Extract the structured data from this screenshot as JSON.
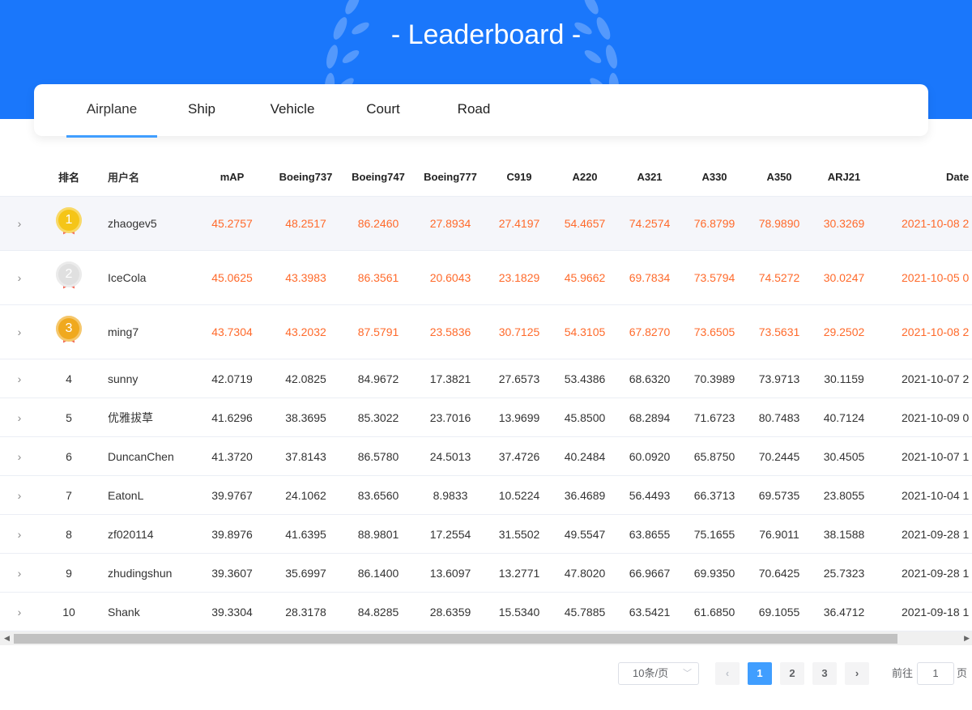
{
  "header": {
    "title": "- Leaderboard -",
    "brand_color": "#1a77fb"
  },
  "tabs": [
    {
      "label": "Airplane",
      "active": true
    },
    {
      "label": "Ship"
    },
    {
      "label": "Vehicle"
    },
    {
      "label": "Court"
    },
    {
      "label": "Road"
    }
  ],
  "columns": [
    "排名",
    "用户名",
    "mAP",
    "Boeing737",
    "Boeing747",
    "Boeing777",
    "C919",
    "A220",
    "A321",
    "A330",
    "A350",
    "ARJ21",
    "Date"
  ],
  "rows": [
    {
      "rank": "1",
      "medal": "gold",
      "user": "zhaogev5",
      "vals": [
        "45.2757",
        "48.2517",
        "86.2460",
        "27.8934",
        "27.4197",
        "54.4657",
        "74.2574",
        "76.8799",
        "78.9890",
        "30.3269"
      ],
      "date": "2021-10-08 2"
    },
    {
      "rank": "2",
      "medal": "silver",
      "user": "IceCola",
      "vals": [
        "45.0625",
        "43.3983",
        "86.3561",
        "20.6043",
        "23.1829",
        "45.9662",
        "69.7834",
        "73.5794",
        "74.5272",
        "30.0247"
      ],
      "date": "2021-10-05 0"
    },
    {
      "rank": "3",
      "medal": "bronze",
      "user": "ming7",
      "vals": [
        "43.7304",
        "43.2032",
        "87.5791",
        "23.5836",
        "30.7125",
        "54.3105",
        "67.8270",
        "73.6505",
        "73.5631",
        "29.2502"
      ],
      "date": "2021-10-08 2"
    },
    {
      "rank": "4",
      "user": "sunny",
      "vals": [
        "42.0719",
        "42.0825",
        "84.9672",
        "17.3821",
        "27.6573",
        "53.4386",
        "68.6320",
        "70.3989",
        "73.9713",
        "30.1159"
      ],
      "date": "2021-10-07 2"
    },
    {
      "rank": "5",
      "user": "优雅拔草",
      "vals": [
        "41.6296",
        "38.3695",
        "85.3022",
        "23.7016",
        "13.9699",
        "45.8500",
        "68.2894",
        "71.6723",
        "80.7483",
        "40.7124"
      ],
      "date": "2021-10-09 0"
    },
    {
      "rank": "6",
      "user": "DuncanChen",
      "vals": [
        "41.3720",
        "37.8143",
        "86.5780",
        "24.5013",
        "37.4726",
        "40.2484",
        "60.0920",
        "65.8750",
        "70.2445",
        "30.4505"
      ],
      "date": "2021-10-07 1"
    },
    {
      "rank": "7",
      "user": "EatonL",
      "vals": [
        "39.9767",
        "24.1062",
        "83.6560",
        "8.9833",
        "10.5224",
        "36.4689",
        "56.4493",
        "66.3713",
        "69.5735",
        "23.8055"
      ],
      "date": "2021-10-04 1"
    },
    {
      "rank": "8",
      "user": "zf020114",
      "vals": [
        "39.8976",
        "41.6395",
        "88.9801",
        "17.2554",
        "31.5502",
        "49.5547",
        "63.8655",
        "75.1655",
        "76.9011",
        "38.1588"
      ],
      "date": "2021-09-28 1"
    },
    {
      "rank": "9",
      "user": "zhudingshun",
      "vals": [
        "39.3607",
        "35.6997",
        "86.1400",
        "13.6097",
        "13.2771",
        "47.8020",
        "66.9667",
        "69.9350",
        "70.6425",
        "25.7323"
      ],
      "date": "2021-09-28 1"
    },
    {
      "rank": "10",
      "user": "Shank",
      "vals": [
        "39.3304",
        "28.3178",
        "84.8285",
        "28.6359",
        "15.5340",
        "45.7885",
        "63.5421",
        "61.6850",
        "69.1055",
        "36.4712"
      ],
      "date": "2021-09-18 1"
    }
  ],
  "medal_colors": {
    "gold": "#f5c518",
    "silver": "#e0e0e0",
    "bronze": "#f0a91e",
    "ribbon": "#f26b5b",
    "top_text": "#ff6a2b"
  },
  "pagination": {
    "page_size": "10条/页",
    "pages": [
      "1",
      "2",
      "3"
    ],
    "current": "1",
    "goto_label": "前往",
    "goto_value": "1",
    "page_suffix": "页"
  }
}
